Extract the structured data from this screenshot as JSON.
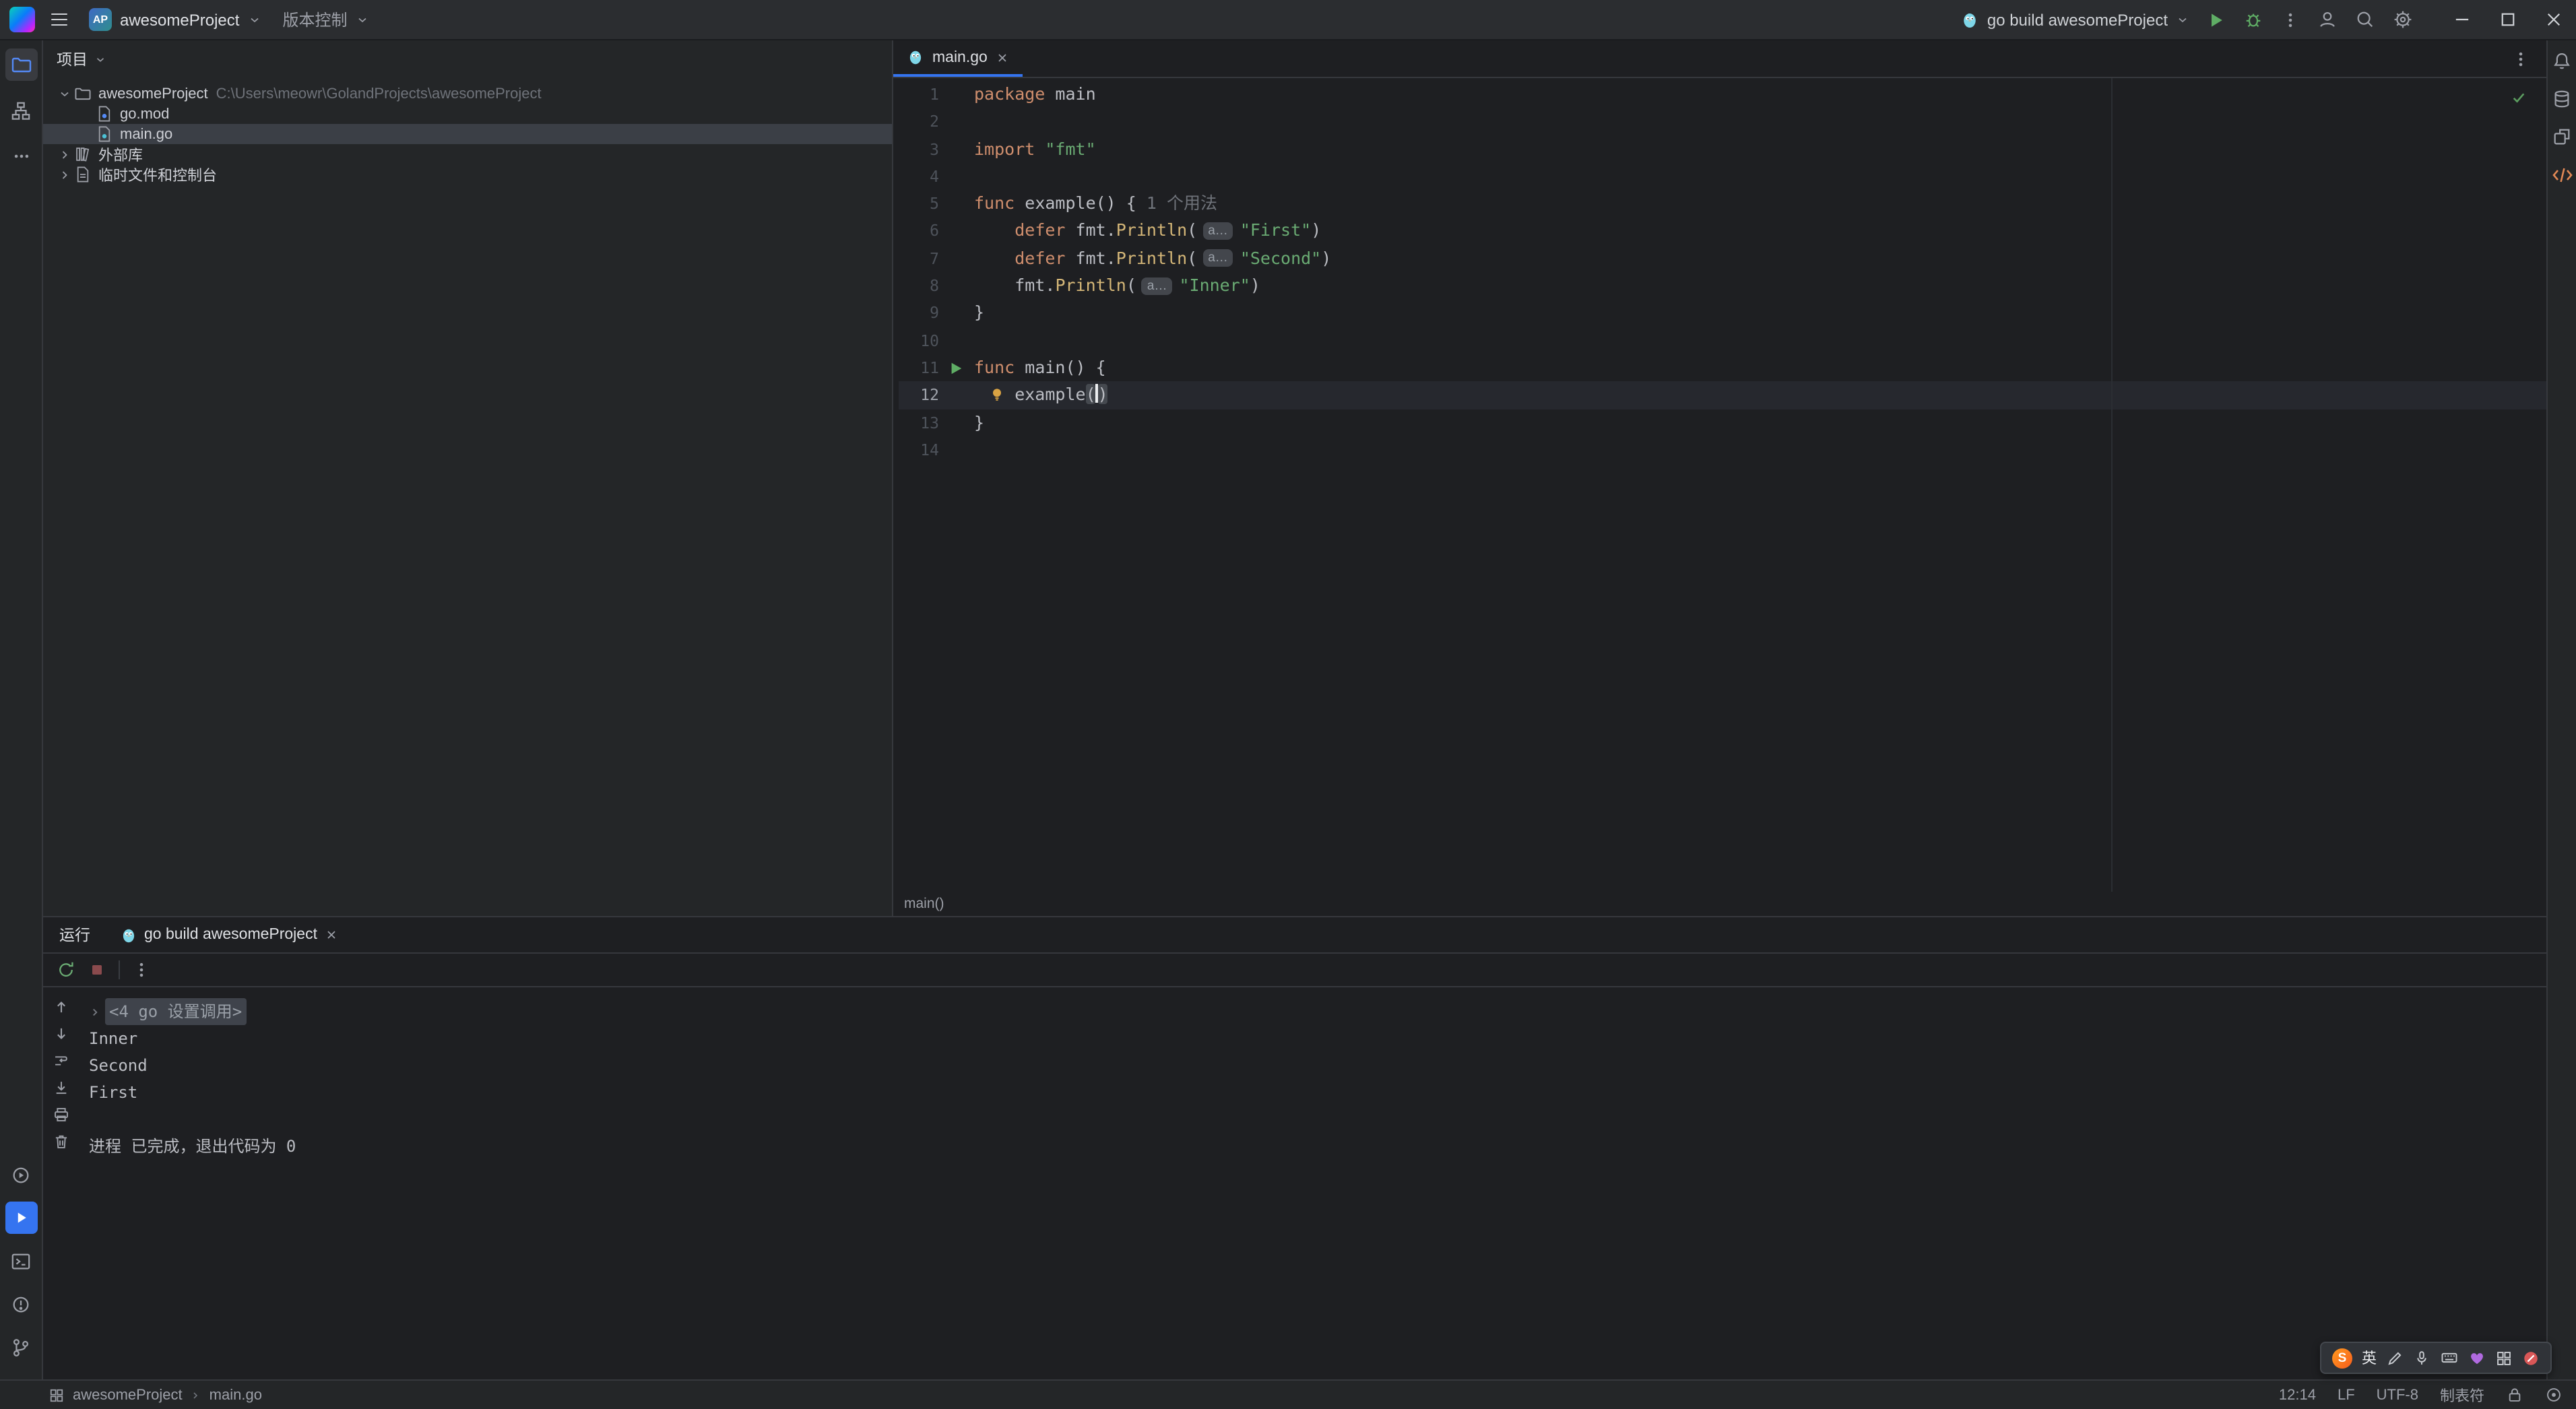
{
  "titlebar": {
    "project_initials": "AP",
    "project_name": "awesomeProject",
    "vcs": "版本控制",
    "run_config": "go build awesomeProject"
  },
  "project": {
    "header": "项目",
    "tree": [
      {
        "indent": 0,
        "chevron": "down",
        "icon": "folder",
        "label": "awesomeProject",
        "path": "C:\\Users\\meowr\\GolandProjects\\awesomeProject",
        "selected": false
      },
      {
        "indent": 1,
        "chevron": "none",
        "icon": "goMod",
        "label": "go.mod",
        "selected": false
      },
      {
        "indent": 1,
        "chevron": "none",
        "icon": "goFile",
        "label": "main.go",
        "selected": true
      },
      {
        "indent": 0,
        "chevron": "right",
        "icon": "library",
        "label": "外部库",
        "selected": false
      },
      {
        "indent": 0,
        "chevron": "right",
        "icon": "scratch",
        "label": "临时文件和控制台",
        "selected": false
      }
    ]
  },
  "editor": {
    "tab_label": "main.go",
    "breadcrumb": "main()",
    "lines": [
      {
        "n": 1,
        "tokens": [
          [
            "kw",
            "package"
          ],
          [
            "pl",
            " main"
          ]
        ]
      },
      {
        "n": 2,
        "tokens": []
      },
      {
        "n": 3,
        "tokens": [
          [
            "kw",
            "import"
          ],
          [
            "pl",
            " "
          ],
          [
            "str",
            "\"fmt\""
          ]
        ]
      },
      {
        "n": 4,
        "tokens": []
      },
      {
        "n": 5,
        "tokens": [
          [
            "kw",
            "func"
          ],
          [
            "pl",
            " example() { "
          ],
          [
            "hint",
            "1 个用法"
          ]
        ]
      },
      {
        "n": 6,
        "tokens": [
          [
            "pl",
            "    "
          ],
          [
            "kw",
            "defer"
          ],
          [
            "pl",
            " fmt."
          ],
          [
            "call",
            "Println"
          ],
          [
            "pl",
            "("
          ],
          [
            "badge",
            "a…"
          ],
          [
            "str",
            "\"First\""
          ],
          [
            "pl",
            ")"
          ]
        ]
      },
      {
        "n": 7,
        "tokens": [
          [
            "pl",
            "    "
          ],
          [
            "kw",
            "defer"
          ],
          [
            "pl",
            " fmt."
          ],
          [
            "call",
            "Println"
          ],
          [
            "pl",
            "("
          ],
          [
            "badge",
            "a…"
          ],
          [
            "str",
            "\"Second\""
          ],
          [
            "pl",
            ")"
          ]
        ]
      },
      {
        "n": 8,
        "tokens": [
          [
            "pl",
            "    fmt."
          ],
          [
            "call",
            "Println"
          ],
          [
            "pl",
            "("
          ],
          [
            "badge",
            "a…"
          ],
          [
            "str",
            "\"Inner\""
          ],
          [
            "pl",
            ")"
          ]
        ]
      },
      {
        "n": 9,
        "tokens": [
          [
            "pl",
            "}"
          ]
        ]
      },
      {
        "n": 10,
        "tokens": []
      },
      {
        "n": 11,
        "gutter": "run",
        "tokens": [
          [
            "kw",
            "func"
          ],
          [
            "pl",
            " main() {"
          ]
        ]
      },
      {
        "n": 12,
        "caret_line": true,
        "bulb": true,
        "tokens": [
          [
            "pl",
            "    example"
          ],
          [
            "brace",
            "("
          ],
          [
            "caret",
            ""
          ],
          [
            "brace",
            ")"
          ]
        ]
      },
      {
        "n": 13,
        "tokens": [
          [
            "pl",
            "}"
          ]
        ]
      },
      {
        "n": 14,
        "tokens": []
      }
    ]
  },
  "run": {
    "title": "运行",
    "tab": "go build awesomeProject",
    "console": [
      {
        "type": "cmd",
        "text": "<4 go 设置调用>"
      },
      {
        "type": "out",
        "text": "Inner"
      },
      {
        "type": "out",
        "text": "Second"
      },
      {
        "type": "out",
        "text": "First"
      },
      {
        "type": "out",
        "text": ""
      },
      {
        "type": "sys",
        "text": "进程 已完成，退出代码为 0"
      }
    ]
  },
  "statusbar": {
    "left_project": "awesomeProject",
    "left_file": "main.go",
    "cursor_position": "12:14",
    "line_ending": "LF",
    "encoding": "UTF-8",
    "indent": "制表符"
  },
  "ime": {
    "logo": "S",
    "lang": "英"
  }
}
